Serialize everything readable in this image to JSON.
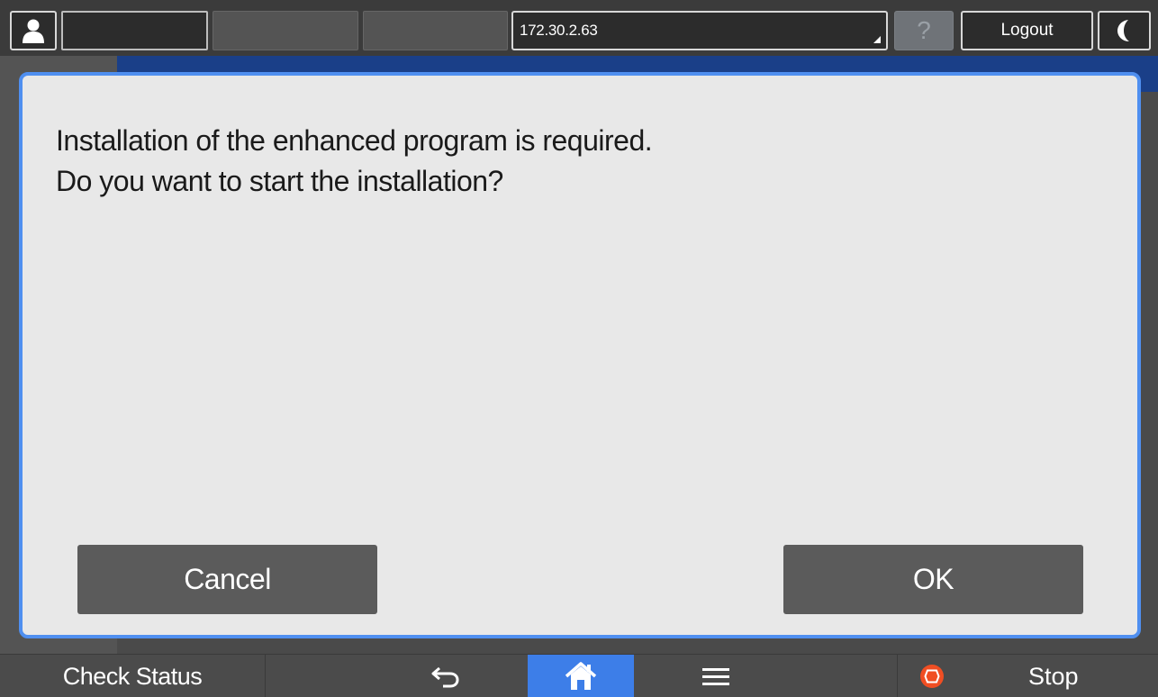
{
  "topbar": {
    "address": "172.30.2.63",
    "help_label": "?",
    "logout_label": "Logout"
  },
  "dialog": {
    "message_line1": "Installation of the enhanced program is required.",
    "message_line2": "Do you want to start the installation?",
    "cancel_label": "Cancel",
    "ok_label": "OK"
  },
  "bottombar": {
    "check_status_label": "Check Status",
    "stop_label": "Stop"
  },
  "colors": {
    "dialog_border": "#4f8ff0",
    "home_active": "#3d7ee8",
    "stop_icon": "#f04e23"
  },
  "icons": [
    "user-icon",
    "help-icon",
    "moon-icon",
    "back-arrow-icon",
    "home-icon",
    "menu-icon",
    "stop-icon"
  ]
}
